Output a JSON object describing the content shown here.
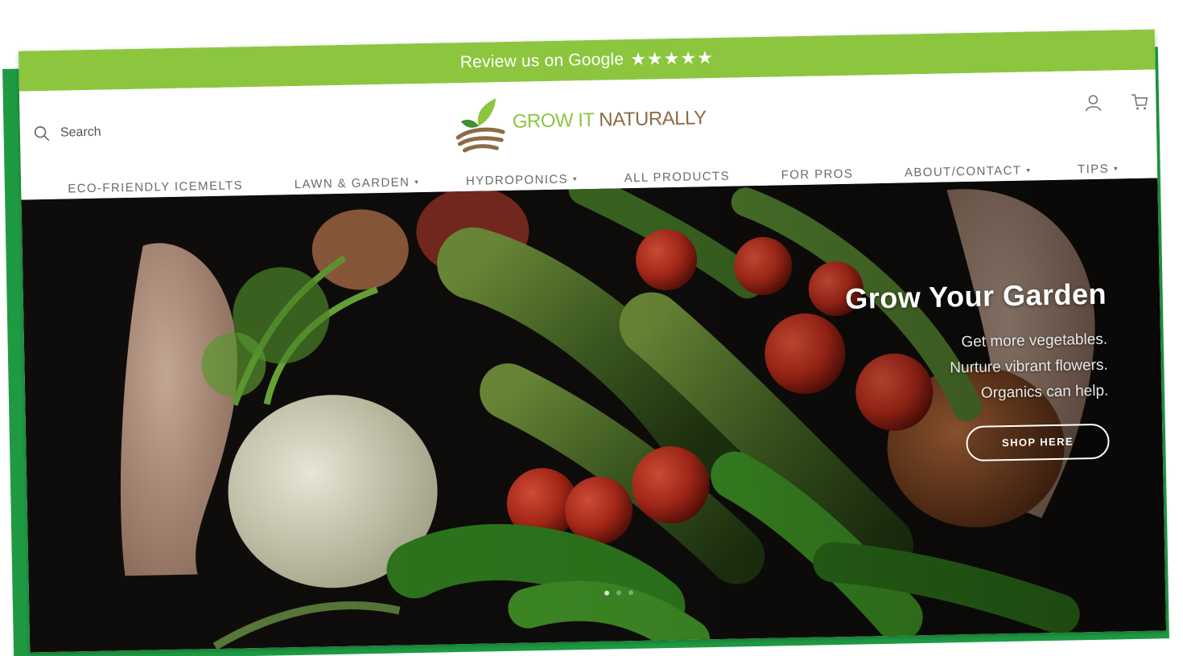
{
  "promo": {
    "text": "Review us on Google",
    "stars": "★★★★★"
  },
  "header": {
    "search_label": "Search",
    "logo": {
      "grow": "GROW IT",
      "naturally": "NATURALLY"
    }
  },
  "nav": {
    "items": [
      {
        "label": "ECO-FRIENDLY ICEMELTS",
        "caret": ""
      },
      {
        "label": "LAWN & GARDEN",
        "caret": "▾"
      },
      {
        "label": "HYDROPONICS",
        "caret": "▾"
      },
      {
        "label": "ALL PRODUCTS",
        "caret": ""
      },
      {
        "label": "FOR PROS",
        "caret": ""
      },
      {
        "label": "ABOUT/CONTACT",
        "caret": "▾"
      },
      {
        "label": "TIPS",
        "caret": "▾"
      }
    ]
  },
  "hero": {
    "title": "Grow Your Garden",
    "lines": [
      "Get more vegetables.",
      "Nurture vibrant flowers.",
      "Organics can help."
    ],
    "button": "SHOP HERE",
    "slides_total": 3,
    "slide_active": 1
  },
  "icons": {
    "search": "search-icon",
    "account": "user-icon",
    "cart": "cart-icon",
    "logo": "sprout-logo-icon"
  },
  "colors": {
    "promo_bar": "#8cc63f",
    "frame": "#1f9a43",
    "logo_green": "#8cc63f",
    "logo_brown": "#8c6b45"
  }
}
